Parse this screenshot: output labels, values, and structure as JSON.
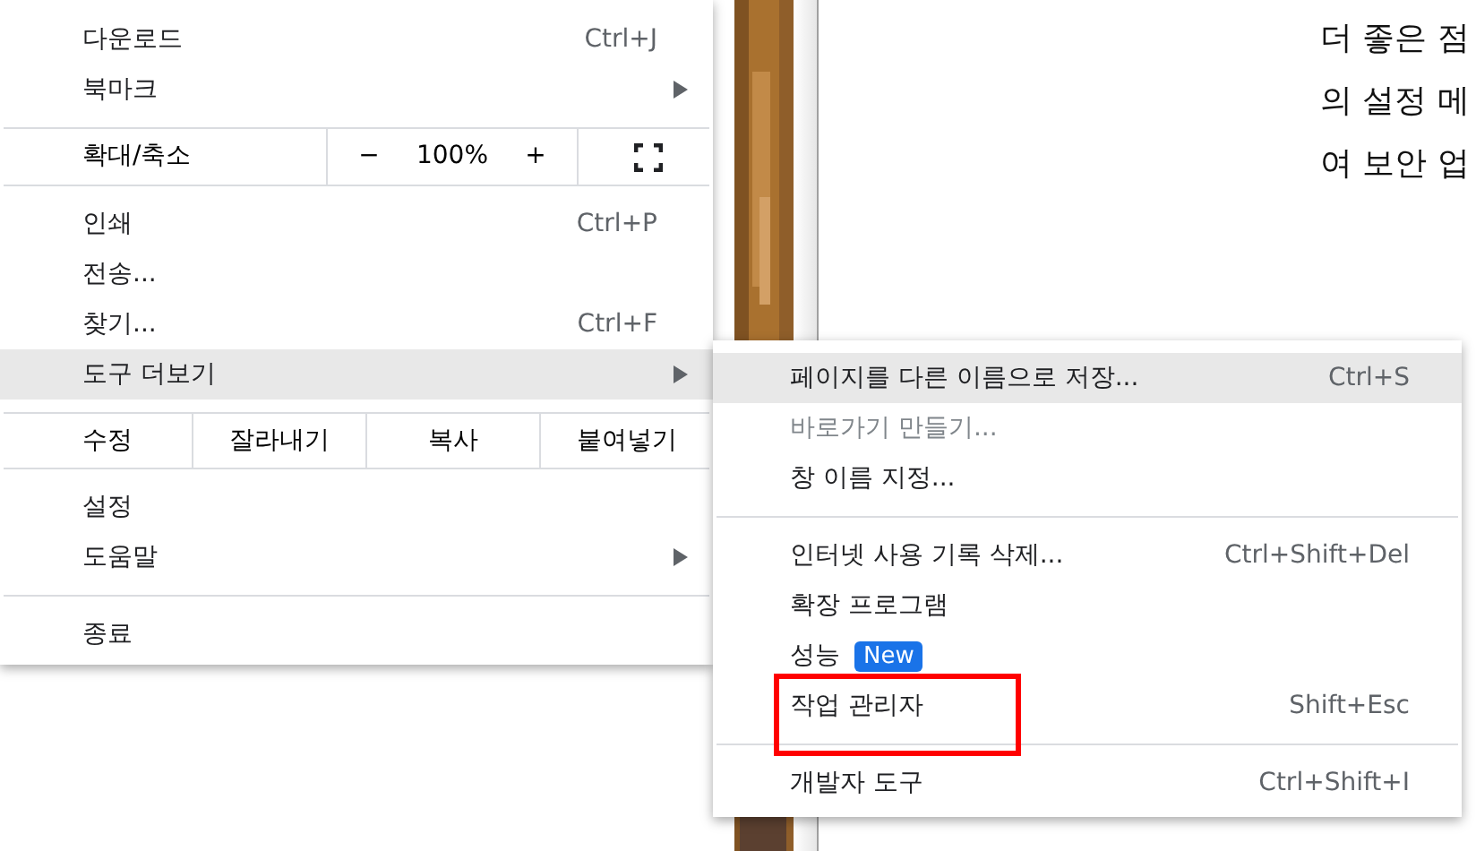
{
  "page": {
    "lines": [
      "더 좋은 점",
      "의 설정 메",
      "여 보안 업"
    ]
  },
  "main_menu": [
    {
      "kind": "item",
      "label": "다운로드",
      "shortcut": "Ctrl+J",
      "submenu": false,
      "selected": false
    },
    {
      "kind": "item",
      "label": "북마크",
      "submenu": true,
      "selected": false
    },
    {
      "kind": "divider"
    },
    {
      "kind": "zoom",
      "label": "확대/축소",
      "minus": "−",
      "value": "100%",
      "plus": "+"
    },
    {
      "kind": "divider"
    },
    {
      "kind": "item",
      "label": "인쇄",
      "shortcut": "Ctrl+P",
      "submenu": false,
      "selected": false
    },
    {
      "kind": "item",
      "label": "전송...",
      "submenu": false,
      "selected": false
    },
    {
      "kind": "item",
      "label": "찾기...",
      "shortcut": "Ctrl+F",
      "submenu": false,
      "selected": false
    },
    {
      "kind": "item",
      "label": "도구 더보기",
      "submenu": true,
      "selected": true
    },
    {
      "kind": "divider"
    },
    {
      "kind": "edit",
      "label": "수정",
      "actions": [
        "잘라내기",
        "복사",
        "붙여넣기"
      ]
    },
    {
      "kind": "divider"
    },
    {
      "kind": "item",
      "label": "설정",
      "submenu": false,
      "selected": false
    },
    {
      "kind": "item",
      "label": "도움말",
      "submenu": true,
      "selected": false
    },
    {
      "kind": "divider"
    },
    {
      "kind": "item",
      "label": "종료",
      "submenu": false,
      "selected": false
    }
  ],
  "submenu": [
    {
      "kind": "item",
      "label": "페이지를 다른 이름으로 저장...",
      "shortcut": "Ctrl+S",
      "selected": true,
      "disabled": false,
      "highlighted_frame": false
    },
    {
      "kind": "item",
      "label": "바로가기 만들기...",
      "selected": false,
      "disabled": true,
      "highlighted_frame": false
    },
    {
      "kind": "item",
      "label": "창 이름 지정...",
      "selected": false,
      "disabled": false,
      "highlighted_frame": false
    },
    {
      "kind": "divider"
    },
    {
      "kind": "item",
      "label": "인터넷 사용 기록 삭제...",
      "shortcut": "Ctrl+Shift+Del",
      "selected": false,
      "disabled": false,
      "highlighted_frame": false
    },
    {
      "kind": "item",
      "label": "확장 프로그램",
      "selected": false,
      "disabled": false,
      "highlighted_frame": false
    },
    {
      "kind": "item",
      "label": "성능",
      "badge": "New",
      "selected": false,
      "disabled": false,
      "highlighted_frame": false
    },
    {
      "kind": "item",
      "label": "작업 관리자",
      "shortcut": "Shift+Esc",
      "selected": false,
      "disabled": false,
      "highlighted_frame": true
    },
    {
      "kind": "divider"
    },
    {
      "kind": "item",
      "label": "개발자 도구",
      "shortcut": "Ctrl+Shift+I",
      "selected": false,
      "disabled": false,
      "highlighted_frame": false
    }
  ]
}
